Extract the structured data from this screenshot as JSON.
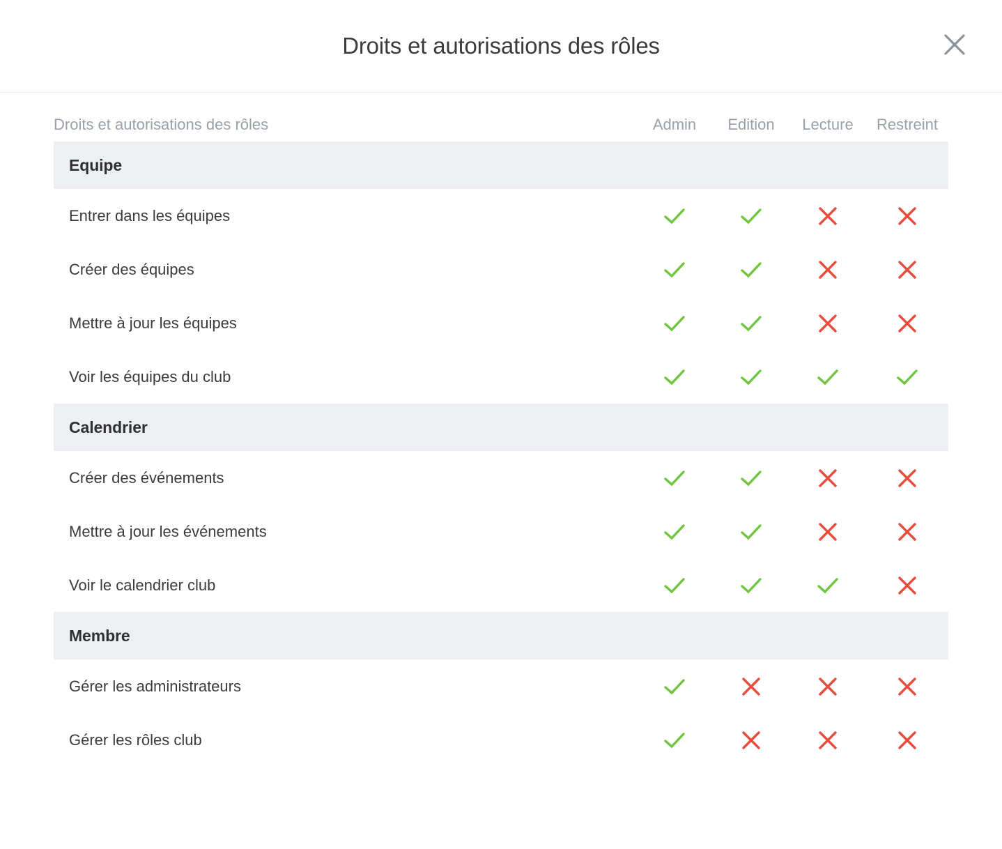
{
  "modal": {
    "title": "Droits et autorisations des rôles",
    "close_icon": "close-icon"
  },
  "table": {
    "row_header_label": "Droits et autorisations des rôles",
    "columns": [
      "Admin",
      "Edition",
      "Lecture",
      "Restreint"
    ],
    "icons": {
      "allowed": "check-icon",
      "denied": "cross-icon"
    },
    "colors": {
      "allowed": "#6fc53e",
      "denied": "#e74c3c",
      "band": "#eeeff3",
      "muted_text": "#9aa0a9",
      "body_text": "#3a3b3e"
    },
    "sections": [
      {
        "title": "Equipe",
        "rows": [
          {
            "label": "Entrer dans les équipes",
            "values": [
              "allowed",
              "allowed",
              "denied",
              "denied"
            ]
          },
          {
            "label": "Créer des équipes",
            "values": [
              "allowed",
              "allowed",
              "denied",
              "denied"
            ]
          },
          {
            "label": "Mettre à jour les équipes",
            "values": [
              "allowed",
              "allowed",
              "denied",
              "denied"
            ]
          },
          {
            "label": "Voir les équipes du club",
            "values": [
              "allowed",
              "allowed",
              "allowed",
              "allowed"
            ]
          }
        ]
      },
      {
        "title": "Calendrier",
        "rows": [
          {
            "label": "Créer des événements",
            "values": [
              "allowed",
              "allowed",
              "denied",
              "denied"
            ]
          },
          {
            "label": "Mettre à jour les événements",
            "values": [
              "allowed",
              "allowed",
              "denied",
              "denied"
            ]
          },
          {
            "label": "Voir le calendrier club",
            "values": [
              "allowed",
              "allowed",
              "allowed",
              "denied"
            ]
          }
        ]
      },
      {
        "title": "Membre",
        "rows": [
          {
            "label": "Gérer les administrateurs",
            "values": [
              "allowed",
              "denied",
              "denied",
              "denied"
            ]
          },
          {
            "label": "Gérer les rôles club",
            "values": [
              "allowed",
              "denied",
              "denied",
              "denied"
            ]
          }
        ]
      }
    ]
  }
}
